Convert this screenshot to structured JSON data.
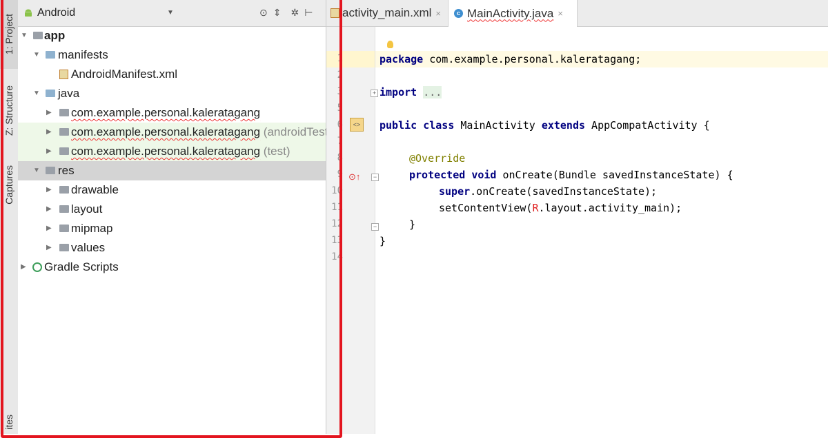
{
  "tool_window_strip": {
    "project_tab": "1: Project",
    "structure_tab": "Z: Structure",
    "captures_tab": "Captures",
    "favorites_tab": "ites"
  },
  "project_panel": {
    "view_mode": "Android",
    "tree": [
      {
        "label": "app",
        "bold": true
      },
      {
        "label": "manifests"
      },
      {
        "label": "AndroidManifest.xml"
      },
      {
        "label": "java"
      },
      {
        "label": "com.example.personal.kaleratagang",
        "suffix": ""
      },
      {
        "label": "com.example.personal.kaleratagang",
        "suffix": "(androidTest)"
      },
      {
        "label": "com.example.personal.kaleratagang",
        "suffix": "(test)"
      },
      {
        "label": "res"
      },
      {
        "label": "drawable"
      },
      {
        "label": "layout"
      },
      {
        "label": "mipmap"
      },
      {
        "label": "values"
      },
      {
        "label": "Gradle Scripts"
      }
    ]
  },
  "editor_tabs": [
    {
      "label": "activity_main.xml",
      "close": "×"
    },
    {
      "label": "MainActivity.java",
      "close": "×",
      "active": true
    }
  ],
  "editor": {
    "line_numbers": [
      "1",
      "2",
      "3",
      "5",
      "6",
      "7",
      "8",
      "9",
      "10",
      "11",
      "12",
      "13",
      "14"
    ],
    "code": {
      "l1_kw": "package",
      "l1_rest": " com.example.personal.kaleratagang;",
      "l3_kw": "import",
      "l3_fold": "...",
      "l6_kw1": "public",
      "l6_kw2": "class",
      "l6_name": "MainActivity",
      "l6_kw3": "extends",
      "l6_rest": " AppCompatActivity {",
      "l8_ann": "@Override",
      "l9_kw1": "protected",
      "l9_kw2": "void",
      "l9_rest": " onCreate(Bundle savedInstanceState) {",
      "l10_kw": "super",
      "l10_rest": ".onCreate(savedInstanceState);",
      "l11_a": "setContentView(",
      "l11_r": "R",
      "l11_b": ".layout.activity_main);",
      "l12": "}",
      "l13": "}"
    }
  },
  "colors": {
    "annotation_frame": "#e3151f",
    "keyword": "#000080",
    "annotation": "#808000"
  }
}
